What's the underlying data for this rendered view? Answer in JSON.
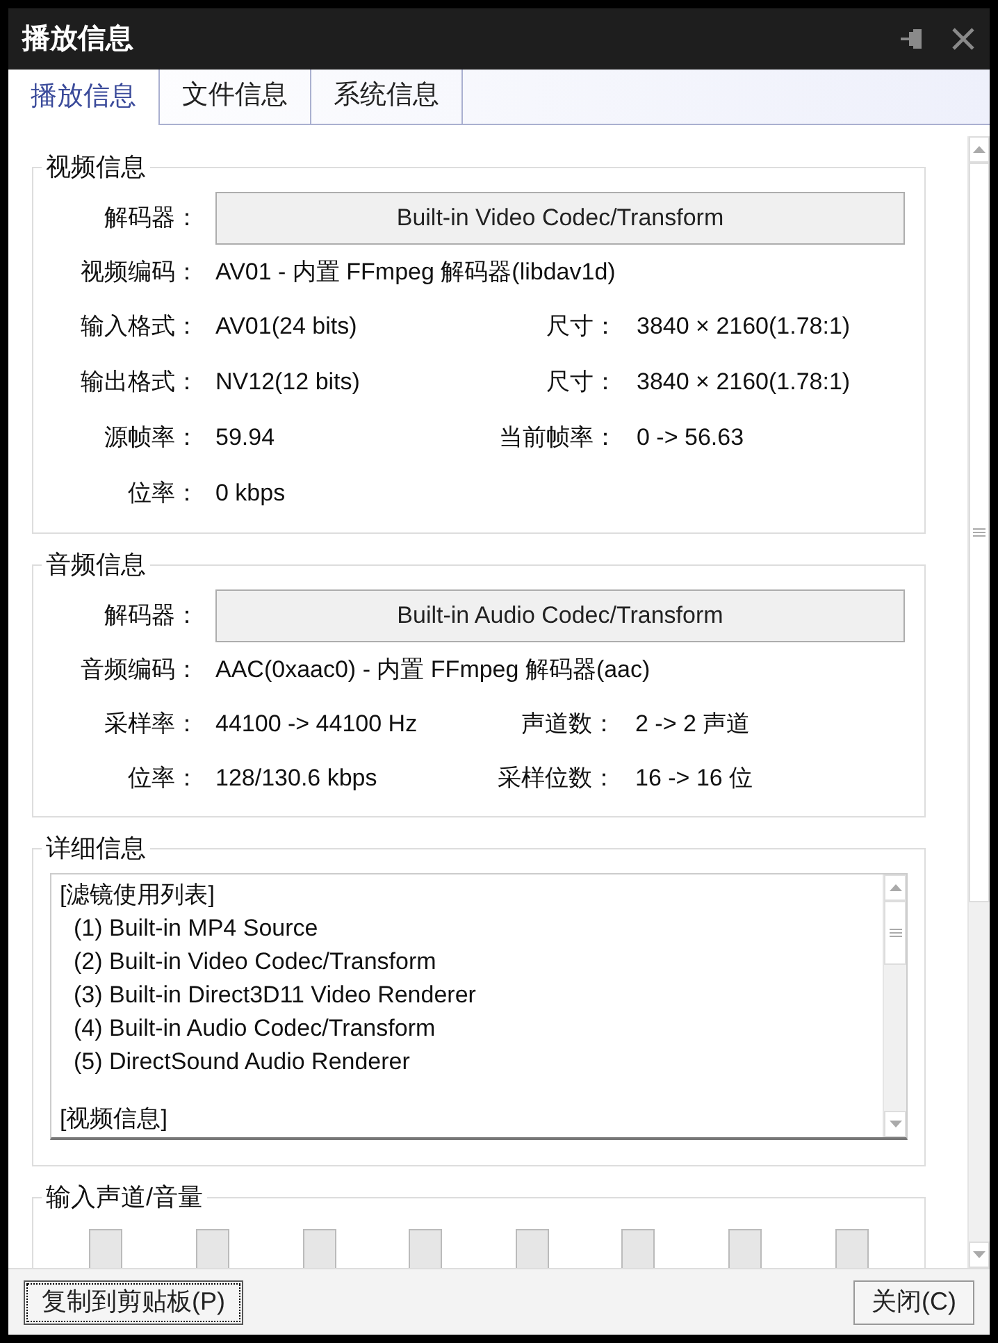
{
  "window": {
    "title": "播放信息"
  },
  "tabs": [
    {
      "label": "播放信息",
      "selected": true
    },
    {
      "label": "文件信息",
      "selected": false
    },
    {
      "label": "系统信息",
      "selected": false
    }
  ],
  "video": {
    "legend": "视频信息",
    "decoder_label": "解码器：",
    "decoder": "Built-in Video Codec/Transform",
    "rows": [
      [
        {
          "label": "视频编码：",
          "value": "AV01 - 内置 FFmpeg 解码器(libdav1d)"
        }
      ],
      [
        {
          "label": "输入格式：",
          "value": "AV01(24 bits)"
        },
        {
          "label": "尺寸：",
          "value": "3840 × 2160(1.78:1)"
        }
      ],
      [
        {
          "label": "输出格式：",
          "value": "NV12(12 bits)"
        },
        {
          "label": "尺寸：",
          "value": "3840 × 2160(1.78:1)"
        }
      ],
      [
        {
          "label": "源帧率：",
          "value": "59.94"
        },
        {
          "label": "当前帧率：",
          "value": "0 -> 56.63"
        }
      ],
      [
        {
          "label": "位率：",
          "value": "0 kbps"
        }
      ]
    ]
  },
  "audio": {
    "legend": "音频信息",
    "decoder_label": "解码器：",
    "decoder": "Built-in Audio Codec/Transform",
    "rows": [
      [
        {
          "label": "音频编码：",
          "value": "AAC(0xaac0) - 内置 FFmpeg 解码器(aac)"
        }
      ],
      [
        {
          "label": "采样率：",
          "value": "44100 -> 44100 Hz"
        },
        {
          "label": "声道数：",
          "value": "2 -> 2 声道"
        }
      ],
      [
        {
          "label": "位率：",
          "value": "128/130.6 kbps"
        },
        {
          "label": "采样位数：",
          "value": "16 -> 16 位"
        }
      ]
    ]
  },
  "details": {
    "legend": "详细信息",
    "lines": [
      {
        "kind": "heading",
        "text": "[滤镜使用列表]"
      },
      {
        "kind": "item",
        "text": "(1) Built-in MP4 Source"
      },
      {
        "kind": "item",
        "text": "(2) Built-in Video Codec/Transform"
      },
      {
        "kind": "item",
        "text": "(3) Built-in Direct3D11 Video Renderer"
      },
      {
        "kind": "item",
        "text": "(4) Built-in Audio Codec/Transform"
      },
      {
        "kind": "item",
        "text": "(5) DirectSound Audio Renderer"
      },
      {
        "kind": "heading",
        "text": "[视频信息]"
      }
    ]
  },
  "volume": {
    "legend": "输入声道/音量"
  },
  "buttons": [
    {
      "label": "复制到剪贴板(P)",
      "focused": true
    },
    {
      "label": "关闭(C)",
      "focused": false
    }
  ]
}
